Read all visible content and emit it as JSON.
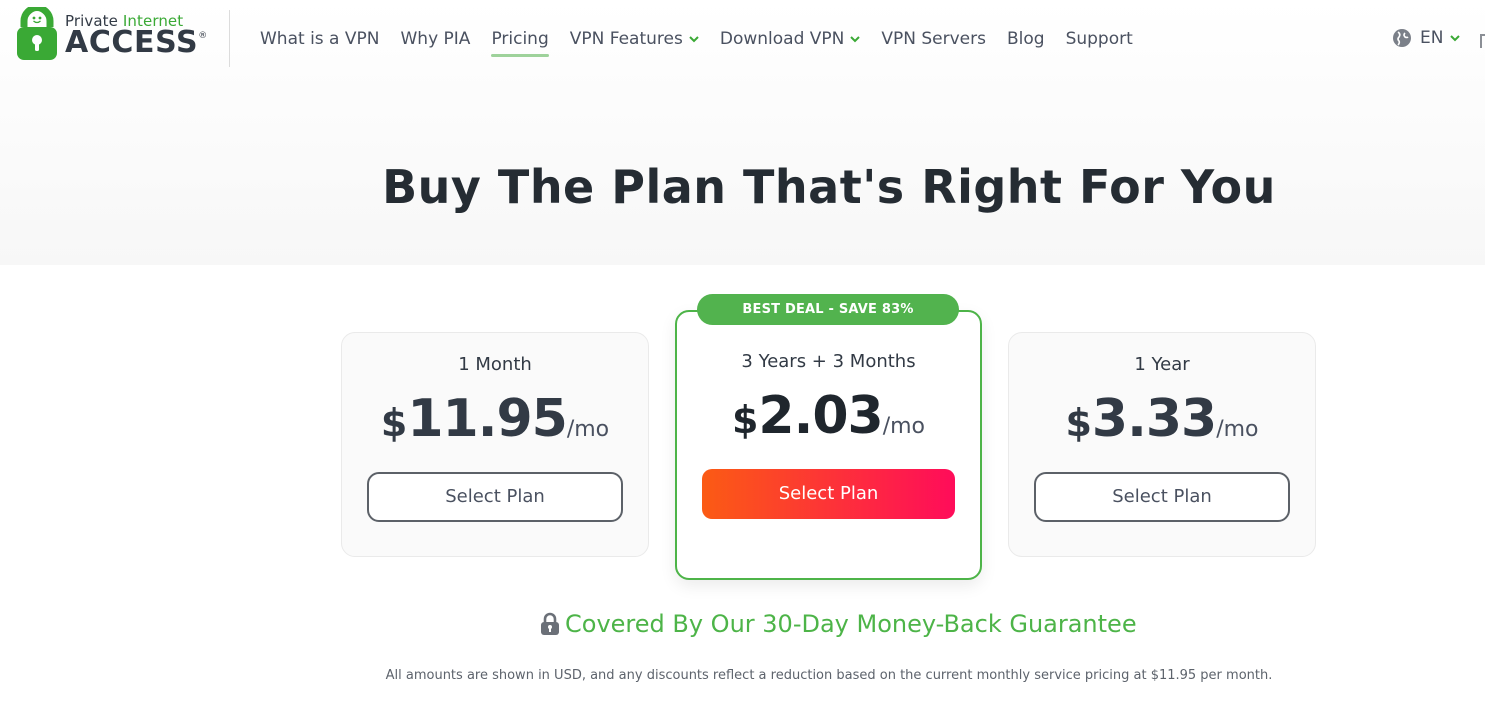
{
  "brand": {
    "line1_a": "Private",
    "line1_b": "Internet",
    "line2": "ACCESS",
    "registered": "®",
    "accent_color": "#3aa935"
  },
  "nav": {
    "items": [
      {
        "label": "What is a VPN",
        "dropdown": false,
        "active": false
      },
      {
        "label": "Why PIA",
        "dropdown": false,
        "active": false
      },
      {
        "label": "Pricing",
        "dropdown": false,
        "active": true
      },
      {
        "label": "VPN Features",
        "dropdown": true,
        "active": false
      },
      {
        "label": "Download VPN",
        "dropdown": true,
        "active": false
      },
      {
        "label": "VPN Servers",
        "dropdown": false,
        "active": false
      },
      {
        "label": "Blog",
        "dropdown": false,
        "active": false
      },
      {
        "label": "Support",
        "dropdown": false,
        "active": false
      }
    ],
    "language": "EN",
    "language_icon": "globe-icon"
  },
  "page": {
    "title": "Buy The Plan That's Right For You"
  },
  "plans": {
    "left": {
      "name": "1 Month",
      "currency": "$",
      "amount": "11.95",
      "per": "/mo",
      "button": "Select Plan"
    },
    "middle": {
      "badge": "BEST DEAL - SAVE 83%",
      "name": "3 Years + 3 Months",
      "currency": "$",
      "amount": "2.03",
      "per": "/mo",
      "button": "Select Plan"
    },
    "right": {
      "name": "1 Year",
      "currency": "$",
      "amount": "3.33",
      "per": "/mo",
      "button": "Select Plan"
    }
  },
  "guarantee": {
    "text": "Covered By Our 30-Day Money-Back Guarantee",
    "icon": "lock-icon"
  },
  "footnote": "All amounts are shown in USD, and any discounts reflect a reduction based on the current monthly service pricing at $11.95 per month.",
  "colors": {
    "green": "#4db448",
    "button_gradient_start": "#fb5b14",
    "button_gradient_end": "#ff0c5a"
  }
}
